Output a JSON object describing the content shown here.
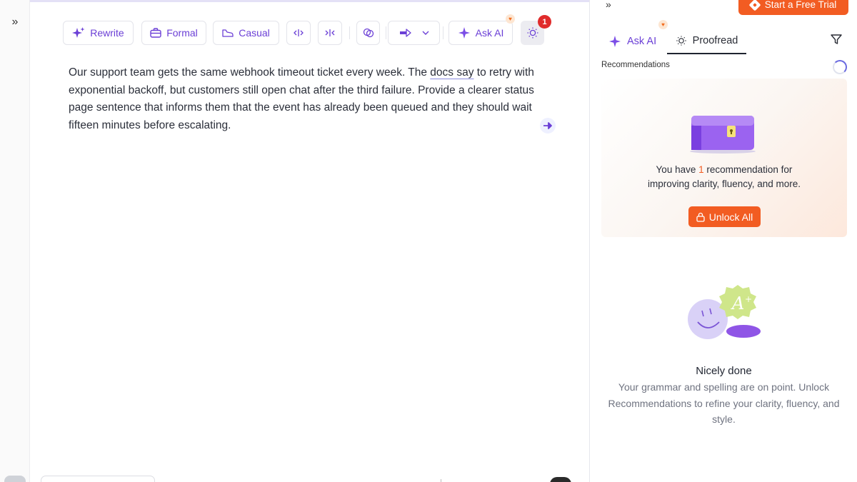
{
  "left_rail": {
    "expand_icon": "chevrons-right-icon",
    "expand_glyph": "»"
  },
  "toolbar": {
    "rewrite_label": "Rewrite",
    "formal_label": "Formal",
    "casual_label": "Casual",
    "ask_ai_label": "Ask AI",
    "hint_badge_count": "1"
  },
  "document": {
    "before_link": "Our support team gets the same webhook timeout ticket every week. The ",
    "linked_phrase": "docs say",
    "after_link": " to retry with exponential backoff, but customers still open chat after the third failure. Provide a clearer status page sentence that informs them that the event has already been queued and they should wait fifteen minutes before escalating."
  },
  "panel": {
    "collapse_glyph": "»",
    "trial_label": "Start a Free Trial",
    "tabs": {
      "ask_ai": "Ask AI",
      "proofread": "Proofread"
    },
    "recommendations_label": "Recommendations",
    "upsell": {
      "line_prefix": "You have ",
      "count": "1",
      "line_suffix": " recommendation for",
      "line2": "improving clarity, fluency, and more.",
      "button": "Unlock All"
    },
    "done": {
      "title": "Nicely done",
      "body": "Your grammar and spelling are on point. Unlock Recommendations to refine your clarity, fluency, and style."
    }
  },
  "colors": {
    "accent": "#6b3fd6",
    "brand_orange": "#f25c22",
    "badge_red": "#e02b2b"
  }
}
